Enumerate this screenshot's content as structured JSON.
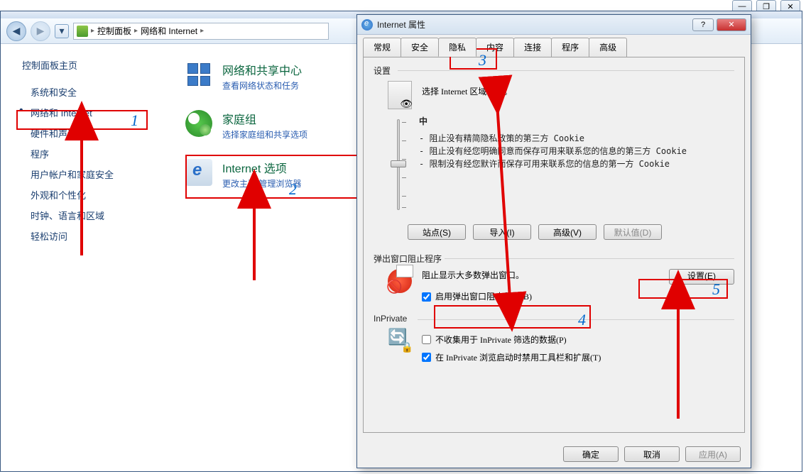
{
  "outer_ctrls": {
    "min": "—",
    "max": "❐",
    "close": "✕"
  },
  "toolbar": {
    "path_root": "控制面板",
    "path_cur": "网络和 Internet"
  },
  "sidebar": {
    "header": "控制面板主页",
    "items": [
      {
        "label": "系统和安全"
      },
      {
        "label": "网络和 Internet"
      },
      {
        "label": "硬件和声音"
      },
      {
        "label": "程序"
      },
      {
        "label": "用户帐户和家庭安全"
      },
      {
        "label": "外观和个性化"
      },
      {
        "label": "时钟、语言和区域"
      },
      {
        "label": "轻松访问"
      }
    ]
  },
  "main_items": [
    {
      "title": "网络和共享中心",
      "sub": "查看网络状态和任务"
    },
    {
      "title": "家庭组",
      "sub": "选择家庭组和共享选项"
    },
    {
      "title": "Internet 选项",
      "sub": "更改主页      管理浏览器"
    }
  ],
  "anno": {
    "n1": "1",
    "n2": "2",
    "n3": "3",
    "n4": "4",
    "n5": "5"
  },
  "dialog": {
    "title": "Internet 属性",
    "tabs": [
      "常规",
      "安全",
      "隐私",
      "内容",
      "连接",
      "程序",
      "高级"
    ],
    "settings_label": "设置",
    "settings_desc": "选择 Internet 区域设置。",
    "level": "中",
    "bullets": [
      "- 阻止没有精简隐私政策的第三方 Cookie",
      "- 阻止没有经您明确同意而保存可用来联系您的信息的第三方 Cookie",
      "- 限制没有经您默许而保存可用来联系您的信息的第一方 Cookie"
    ],
    "btn_sites": "站点(S)",
    "btn_import": "导入(I)",
    "btn_advanced": "高级(V)",
    "btn_default": "默认值(D)",
    "popup_label": "弹出窗口阻止程序",
    "popup_desc": "阻止显示大多数弹出窗口。",
    "popup_check": "启用弹出窗口阻止程序(B)",
    "popup_settings": "设置(E)",
    "inprivate_label": "InPrivate",
    "inp_check1": "不收集用于 InPrivate 筛选的数据(P)",
    "inp_check2": "在 InPrivate 浏览启动时禁用工具栏和扩展(T)",
    "ok": "确定",
    "cancel": "取消",
    "apply": "应用(A)",
    "help": "?",
    "close": "✕"
  }
}
